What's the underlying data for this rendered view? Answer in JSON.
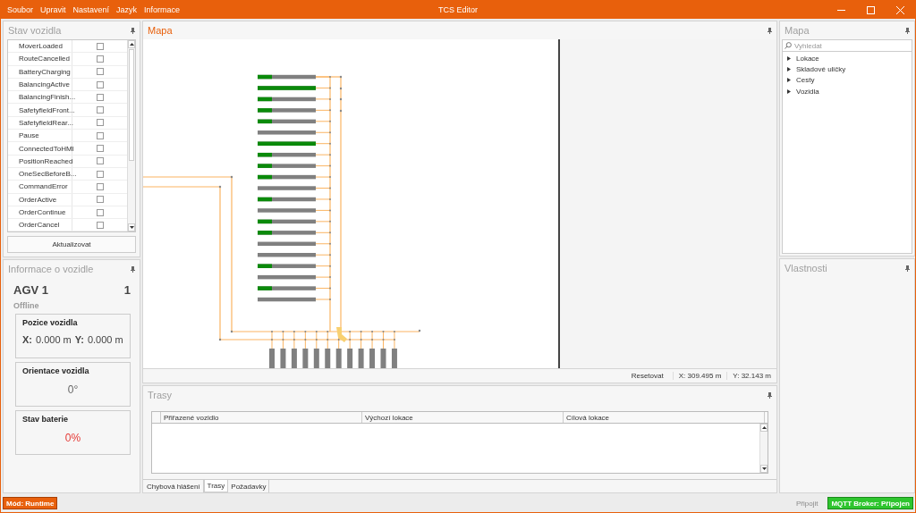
{
  "window": {
    "title": "TCS Editor"
  },
  "menu": [
    "Soubor",
    "Upravit",
    "Nastavení",
    "Jazyk",
    "Informace"
  ],
  "vehicle_state": {
    "title": "Stav vozidla",
    "flags": [
      {
        "label": "MoverLoaded",
        "checked": false
      },
      {
        "label": "RouteCancelled",
        "checked": false
      },
      {
        "label": "BatteryCharging",
        "checked": false
      },
      {
        "label": "BalancingActive",
        "checked": false
      },
      {
        "label": "BalancingFinish...",
        "checked": false
      },
      {
        "label": "SafetyfieldFront...",
        "checked": false
      },
      {
        "label": "SafetyfieldRear...",
        "checked": false
      },
      {
        "label": "Pause",
        "checked": false
      },
      {
        "label": "ConnectedToHMI",
        "checked": false
      },
      {
        "label": "PositionReached",
        "checked": false
      },
      {
        "label": "OneSecBeforeB...",
        "checked": false
      },
      {
        "label": "CommandError",
        "checked": false
      },
      {
        "label": "OrderActive",
        "checked": false
      },
      {
        "label": "OrderContinue",
        "checked": false
      },
      {
        "label": "OrderCancel",
        "checked": false
      }
    ],
    "refresh_button": "Aktualizovat"
  },
  "vehicle_info": {
    "title": "Informace o vozidle",
    "name": "AGV 1",
    "id": "1",
    "status": "Offline",
    "position": {
      "title": "Pozice vozidla",
      "x_label": "X:",
      "x": "0.000 m",
      "y_label": "Y:",
      "y": "0.000 m"
    },
    "orientation": {
      "title": "Orientace vozidla",
      "value": "0°"
    },
    "battery": {
      "title": "Stav baterie",
      "value": "0%"
    }
  },
  "map": {
    "title": "Mapa",
    "aisles": [
      {
        "kind": "marked"
      },
      {
        "kind": "full"
      },
      {
        "kind": "marked"
      },
      {
        "kind": "marked"
      },
      {
        "kind": "marked"
      },
      {
        "kind": "empty"
      },
      {
        "kind": "full"
      },
      {
        "kind": "marked"
      },
      {
        "kind": "marked"
      },
      {
        "kind": "marked"
      },
      {
        "kind": "empty"
      },
      {
        "kind": "marked"
      },
      {
        "kind": "empty"
      },
      {
        "kind": "marked"
      },
      {
        "kind": "marked"
      },
      {
        "kind": "empty"
      },
      {
        "kind": "empty"
      },
      {
        "kind": "marked"
      },
      {
        "kind": "empty"
      },
      {
        "kind": "marked"
      },
      {
        "kind": "empty"
      }
    ],
    "reset_button": "Resetovat",
    "x_readout": "X: 309.495 m",
    "y_readout": "Y: 32.143 m"
  },
  "routes": {
    "title": "Trasy",
    "columns": [
      "Přiřazené vozidlo",
      "Výchozí lokace",
      "Cílová lokace"
    ],
    "tabs": [
      {
        "label": "Chybová hlášení",
        "selected": false
      },
      {
        "label": "Trasy",
        "selected": true
      },
      {
        "label": "Požadavky",
        "selected": false
      }
    ]
  },
  "tree_panel": {
    "title": "Mapa",
    "search": {
      "placeholder": "Vyhledat"
    },
    "items": [
      {
        "label": "Lokace",
        "expanded": false
      },
      {
        "label": "Skladové uličky",
        "expanded": false
      },
      {
        "label": "Cesty",
        "expanded": false
      },
      {
        "label": "Vozidla",
        "expanded": false
      }
    ]
  },
  "properties": {
    "title": "Vlastnosti"
  },
  "status_bar": {
    "mode": "Mód: Runtime",
    "connect": {
      "label": "Připojit",
      "disabled": true
    },
    "broker": "MQTT Broker: Připojen"
  }
}
